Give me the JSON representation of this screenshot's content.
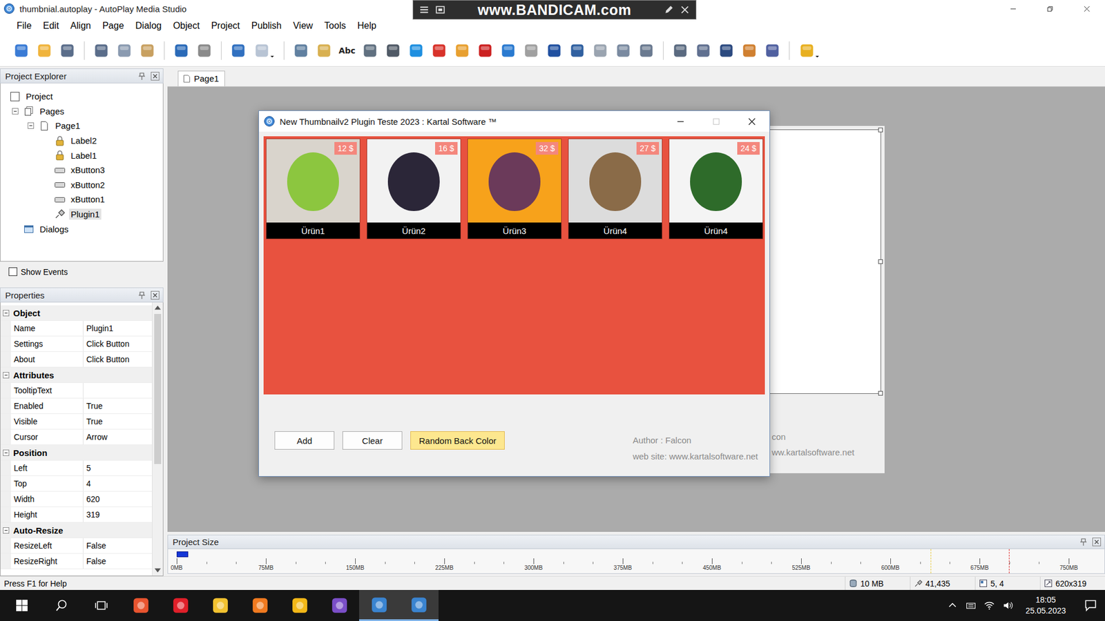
{
  "window": {
    "title": "thumbnial.autoplay - AutoPlay Media Studio"
  },
  "recorder_watermark": {
    "text": "www.BANDICAM.com"
  },
  "menu": [
    "File",
    "Edit",
    "Align",
    "Page",
    "Dialog",
    "Object",
    "Project",
    "Publish",
    "View",
    "Tools",
    "Help"
  ],
  "toolbar": {
    "groups": [
      [
        {
          "kind": "icon",
          "color": "#3a7bd5",
          "dropdown": false
        },
        {
          "kind": "icon",
          "color": "#f0b43c",
          "dropdown": false
        },
        {
          "kind": "icon",
          "color": "#5a6d8a",
          "dropdown": false
        }
      ],
      [
        {
          "kind": "icon",
          "color": "#5a6d8a",
          "dropdown": false
        },
        {
          "kind": "icon",
          "color": "#8a9ab0",
          "dropdown": false
        },
        {
          "kind": "icon",
          "color": "#c8a060",
          "dropdown": false
        }
      ],
      [
        {
          "kind": "icon",
          "color": "#2a6ab8",
          "dropdown": false
        },
        {
          "kind": "icon",
          "color": "#8a8a8a",
          "dropdown": false
        }
      ],
      [
        {
          "kind": "icon",
          "color": "#3070c0",
          "dropdown": false
        },
        {
          "kind": "icon",
          "color": "#b8c4d4",
          "dropdown": true
        }
      ],
      [
        {
          "kind": "icon",
          "color": "#6080a0",
          "dropdown": false
        },
        {
          "kind": "icon",
          "color": "#d8b050",
          "dropdown": false
        },
        {
          "kind": "text",
          "label": "Abc",
          "dropdown": false
        },
        {
          "kind": "icon",
          "color": "#607080",
          "dropdown": false
        },
        {
          "kind": "icon",
          "color": "#505a66",
          "dropdown": false
        },
        {
          "kind": "icon",
          "color": "#1e8fe0",
          "dropdown": false
        },
        {
          "kind": "icon",
          "color": "#d8322a",
          "dropdown": false
        },
        {
          "kind": "icon",
          "color": "#e8a030",
          "dropdown": false
        },
        {
          "kind": "icon",
          "color": "#cc2020",
          "dropdown": false
        },
        {
          "kind": "icon",
          "color": "#2a7ad0",
          "dropdown": false
        },
        {
          "kind": "icon",
          "color": "#a0a0a0",
          "dropdown": false
        },
        {
          "kind": "icon",
          "color": "#2050a0",
          "dropdown": false
        },
        {
          "kind": "icon",
          "color": "#3060a0",
          "dropdown": false
        },
        {
          "kind": "icon",
          "color": "#9aa4b0",
          "dropdown": false
        },
        {
          "kind": "icon",
          "color": "#7a8aa0",
          "dropdown": false
        },
        {
          "kind": "icon",
          "color": "#6a7a90",
          "dropdown": false
        }
      ],
      [
        {
          "kind": "icon",
          "color": "#5a6a80",
          "dropdown": false
        },
        {
          "kind": "icon",
          "color": "#607090",
          "dropdown": false
        },
        {
          "kind": "icon",
          "color": "#2c4a80",
          "dropdown": false
        },
        {
          "kind": "icon",
          "color": "#d08030",
          "dropdown": false
        },
        {
          "kind": "icon",
          "color": "#5060a0",
          "dropdown": false
        }
      ],
      [
        {
          "kind": "icon",
          "color": "#e8b020",
          "dropdown": true
        }
      ]
    ]
  },
  "project_explorer": {
    "title": "Project Explorer",
    "tree": [
      {
        "label": "Project",
        "depth": 0,
        "kind": "project",
        "expandable": false,
        "expanded": true,
        "selected": false
      },
      {
        "label": "Pages",
        "depth": 1,
        "kind": "pages",
        "expandable": true,
        "expanded": true,
        "selected": false
      },
      {
        "label": "Page1",
        "depth": 2,
        "kind": "page",
        "expandable": true,
        "expanded": true,
        "selected": false
      },
      {
        "label": "Label2",
        "depth": 3,
        "kind": "label",
        "expandable": false,
        "expanded": false,
        "selected": false
      },
      {
        "label": "Label1",
        "depth": 3,
        "kind": "label",
        "expandable": false,
        "expanded": false,
        "selected": false
      },
      {
        "label": "xButton3",
        "depth": 3,
        "kind": "button",
        "expandable": false,
        "expanded": false,
        "selected": false
      },
      {
        "label": "xButton2",
        "depth": 3,
        "kind": "button",
        "expandable": false,
        "expanded": false,
        "selected": false
      },
      {
        "label": "xButton1",
        "depth": 3,
        "kind": "button",
        "expandable": false,
        "expanded": false,
        "selected": false
      },
      {
        "label": "Plugin1",
        "depth": 3,
        "kind": "plugin",
        "expandable": false,
        "expanded": false,
        "selected": true
      },
      {
        "label": "Dialogs",
        "depth": 1,
        "kind": "dialogs",
        "expandable": false,
        "expanded": false,
        "selected": false
      }
    ]
  },
  "show_events": {
    "label": "Show Events",
    "checked": false
  },
  "properties": {
    "title": "Properties",
    "scrollbar": {
      "level": 0.6
    },
    "groups": [
      {
        "name": "Object",
        "expanded": true,
        "rows": [
          {
            "key": "Name",
            "value": "Plugin1"
          },
          {
            "key": "Settings",
            "value": "Click Button"
          },
          {
            "key": "About",
            "value": "Click Button"
          }
        ]
      },
      {
        "name": "Attributes",
        "expanded": true,
        "rows": [
          {
            "key": "TooltipText",
            "value": ""
          },
          {
            "key": "Enabled",
            "value": "True"
          },
          {
            "key": "Visible",
            "value": "True"
          },
          {
            "key": "Cursor",
            "value": "Arrow"
          }
        ]
      },
      {
        "name": "Position",
        "expanded": true,
        "rows": [
          {
            "key": "Left",
            "value": "5"
          },
          {
            "key": "Top",
            "value": "4"
          },
          {
            "key": "Width",
            "value": "620"
          },
          {
            "key": "Height",
            "value": "319"
          }
        ]
      },
      {
        "name": "Auto-Resize",
        "expanded": true,
        "rows": [
          {
            "key": "ResizeLeft",
            "value": "False"
          },
          {
            "key": "ResizeRight",
            "value": "False"
          }
        ]
      }
    ]
  },
  "document_tabs": [
    {
      "label": "Page1",
      "selected": true
    }
  ],
  "page": {
    "labels": [
      "con",
      "ww.kartalsoftware.net"
    ],
    "plugin_selected": true
  },
  "dialog": {
    "title": "New Thumbnailv2 Plugin Teste 2023 : Kartal Software ™",
    "maximize_disabled": true,
    "back_color": "#e8523f",
    "products": [
      {
        "name": "Ürün1",
        "price": "12 $",
        "color": "#d9d4cc",
        "accent": "#8cc63f"
      },
      {
        "name": "Ürün2",
        "price": "16 $",
        "color": "#f2f2f2",
        "accent": "#2b2638"
      },
      {
        "name": "Ürün3",
        "price": "32 $",
        "color": "#f7a21b",
        "accent": "#6b3a5a"
      },
      {
        "name": "Ürün4",
        "price": "27 $",
        "color": "#dcdcdc",
        "accent": "#8a6b48"
      },
      {
        "name": "Ürün4",
        "price": "24 $",
        "color": "#f4f4f4",
        "accent": "#2e6b2a"
      }
    ],
    "buttons": [
      {
        "label": "Add",
        "highlighted": false
      },
      {
        "label": "Clear",
        "highlighted": false
      },
      {
        "label": "Random Back Color",
        "highlighted": true
      }
    ],
    "author": "Author : Falcon",
    "website": "web site: www.kartalsoftware.net"
  },
  "project_size": {
    "title": "Project Size",
    "ticks": [
      "0MB",
      "75MB",
      "150MB",
      "225MB",
      "300MB",
      "375MB",
      "450MB",
      "525MB",
      "600MB",
      "675MB",
      "750MB"
    ],
    "level": 0.013,
    "markers": [
      {
        "level": 0.845,
        "color": "#e8c840"
      },
      {
        "level": 0.933,
        "color": "#e03030"
      }
    ]
  },
  "status_bar": {
    "help": "Press F1 for Help",
    "items": [
      "10 MB",
      "41,435",
      "5, 4",
      "620x319"
    ]
  },
  "taskbar": {
    "time": "18:05",
    "date": "25.05.2023",
    "apps": [
      {
        "color": "#e8542f",
        "active": false
      },
      {
        "color": "#e0202a",
        "active": false
      },
      {
        "color": "#f2c230",
        "active": false
      },
      {
        "color": "#f07a20",
        "active": false
      },
      {
        "color": "#f3b818",
        "active": false
      },
      {
        "color": "#7b4fc8",
        "active": false
      },
      {
        "color": "#3a84d0",
        "active": true
      },
      {
        "color": "#3a84d0",
        "active": true
      }
    ]
  }
}
